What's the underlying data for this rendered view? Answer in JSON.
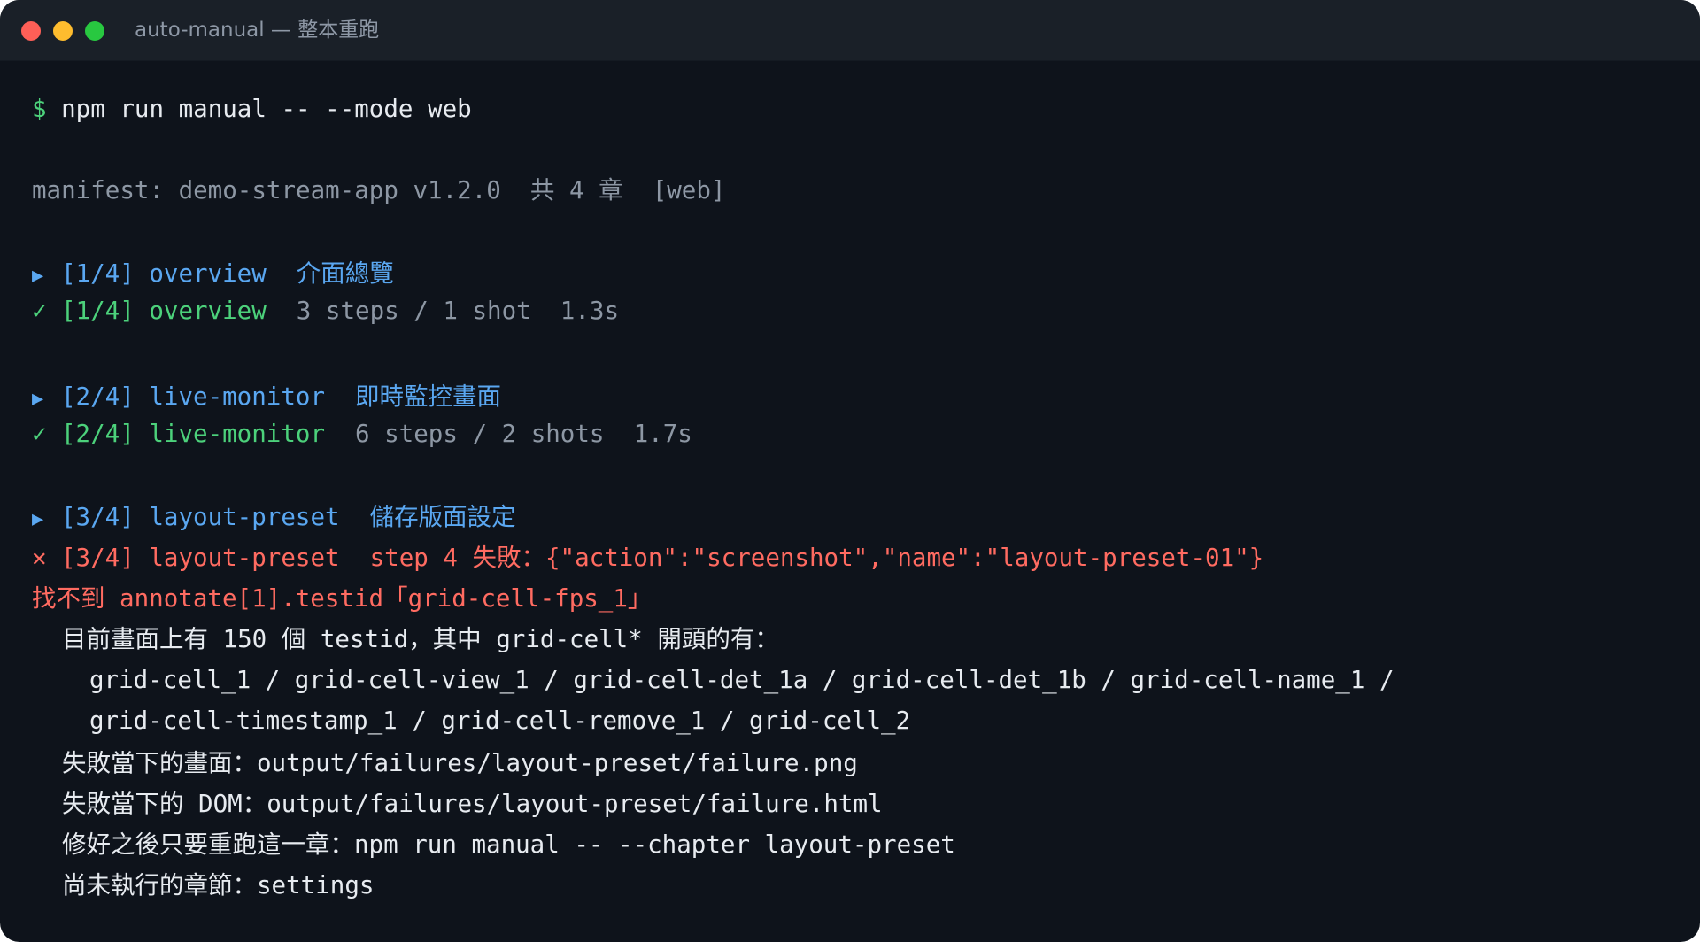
{
  "window": {
    "title": "auto-manual — 整本重跑"
  },
  "command": {
    "prompt": "$",
    "text": "npm run manual -- --mode web"
  },
  "manifest_line": "manifest: demo-stream-app v1.2.0  共 4 章  [web]",
  "chapters": [
    {
      "start": {
        "marker": "▶",
        "label": "[1/4] overview",
        "desc": "介面總覽"
      },
      "done": {
        "marker": "✓",
        "label": "[1/4] overview",
        "stats": "3 steps / 1 shot  1.3s"
      }
    },
    {
      "start": {
        "marker": "▶",
        "label": "[2/4] live-monitor",
        "desc": "即時監控畫面"
      },
      "done": {
        "marker": "✓",
        "label": "[2/4] live-monitor",
        "stats": "6 steps / 2 shots  1.7s"
      }
    },
    {
      "start": {
        "marker": "▶",
        "label": "[3/4] layout-preset",
        "desc": "儲存版面設定"
      },
      "fail": {
        "marker": "✕",
        "label": "[3/4] layout-preset",
        "detail": "step 4 失敗：{\"action\":\"screenshot\",\"name\":\"layout-preset-01\"}"
      }
    }
  ],
  "error": {
    "message": "找不到 annotate[1].testid「grid-cell-fps_1」",
    "summary": "目前畫面上有 150 個 testid，其中 grid-cell* 開頭的有：",
    "candidates_line1": "grid-cell_1 / grid-cell-view_1 / grid-cell-det_1a / grid-cell-det_1b / grid-cell-name_1 /",
    "candidates_line2": "grid-cell-timestamp_1 / grid-cell-remove_1 / grid-cell_2",
    "screenshot_path": "失敗當下的畫面：output/failures/layout-preset/failure.png",
    "dom_path": "失敗當下的 DOM：output/failures/layout-preset/failure.html",
    "rerun_hint": "修好之後只要重跑這一章：npm run manual -- --chapter layout-preset",
    "pending": "尚未執行的章節：settings"
  }
}
